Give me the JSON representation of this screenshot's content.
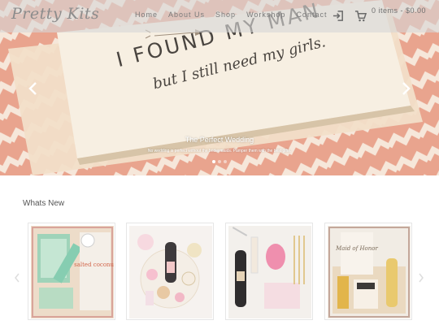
{
  "brand": {
    "logo_text": "Pretty Kits"
  },
  "nav": {
    "items": [
      "Home",
      "About Us",
      "Shop",
      "Workshop",
      "Contact"
    ],
    "login_icon": "login-icon",
    "cart_icon": "cart-icon",
    "cart_summary": "0 items - $0.00"
  },
  "hero": {
    "card_line1": "I FOUND MY MAN",
    "card_line2": "but I still need my girls.",
    "caption_title": "The Perfect Wedding",
    "caption_text": "No wedding is perfect without the bridesmaids. Pamper them with the best gifts.",
    "prev_icon": "chevron-left-icon",
    "next_icon": "chevron-right-icon",
    "slide_count": 3,
    "active_slide": 1
  },
  "whats_new": {
    "title": "Whats New",
    "prev_icon": "chevron-left-icon",
    "next_icon": "chevron-right-icon",
    "products": [
      {
        "label_text": "salted coconut"
      },
      {
        "label_text": ""
      },
      {
        "label_text": ""
      },
      {
        "label_text": "Maid of Honor"
      }
    ]
  },
  "colors": {
    "navbar_bg": "#d7d7d7",
    "nav_text": "#7a7a7a",
    "hero_pattern_pink": "#e9a48e",
    "hero_pattern_cream": "#f6e7da",
    "card_cream": "#f3eadc"
  }
}
